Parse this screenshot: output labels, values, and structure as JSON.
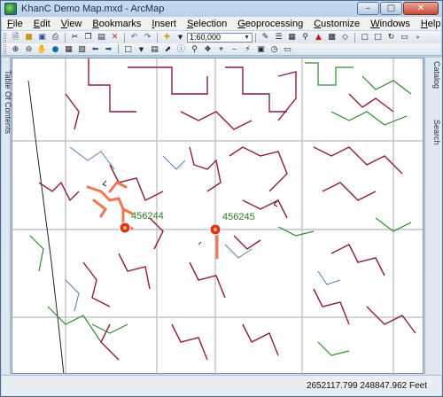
{
  "window": {
    "title": "KhanC Demo Map.mxd - ArcMap"
  },
  "menu": [
    "File",
    "Edit",
    "View",
    "Bookmarks",
    "Insert",
    "Selection",
    "Geoprocessing",
    "Customize",
    "Windows",
    "Help"
  ],
  "toolbar": {
    "scale_value": "1:60,000"
  },
  "panels": {
    "left_tab": "Table Of Contents",
    "right_tab_catalog": "Catalog",
    "right_tab_search": "Search"
  },
  "map": {
    "labels": [
      {
        "id": "a",
        "text": "456244"
      },
      {
        "id": "b",
        "text": "456245"
      }
    ],
    "colors": {
      "water_lines": "#8c1d3a",
      "sewer_lines": "#2e8a2e",
      "storm_lines": "#5a7ab0",
      "highlight": "#f07850",
      "marker": "#e03020"
    }
  },
  "status": {
    "coordinates": "2652117.799  248847.962 Feet"
  }
}
